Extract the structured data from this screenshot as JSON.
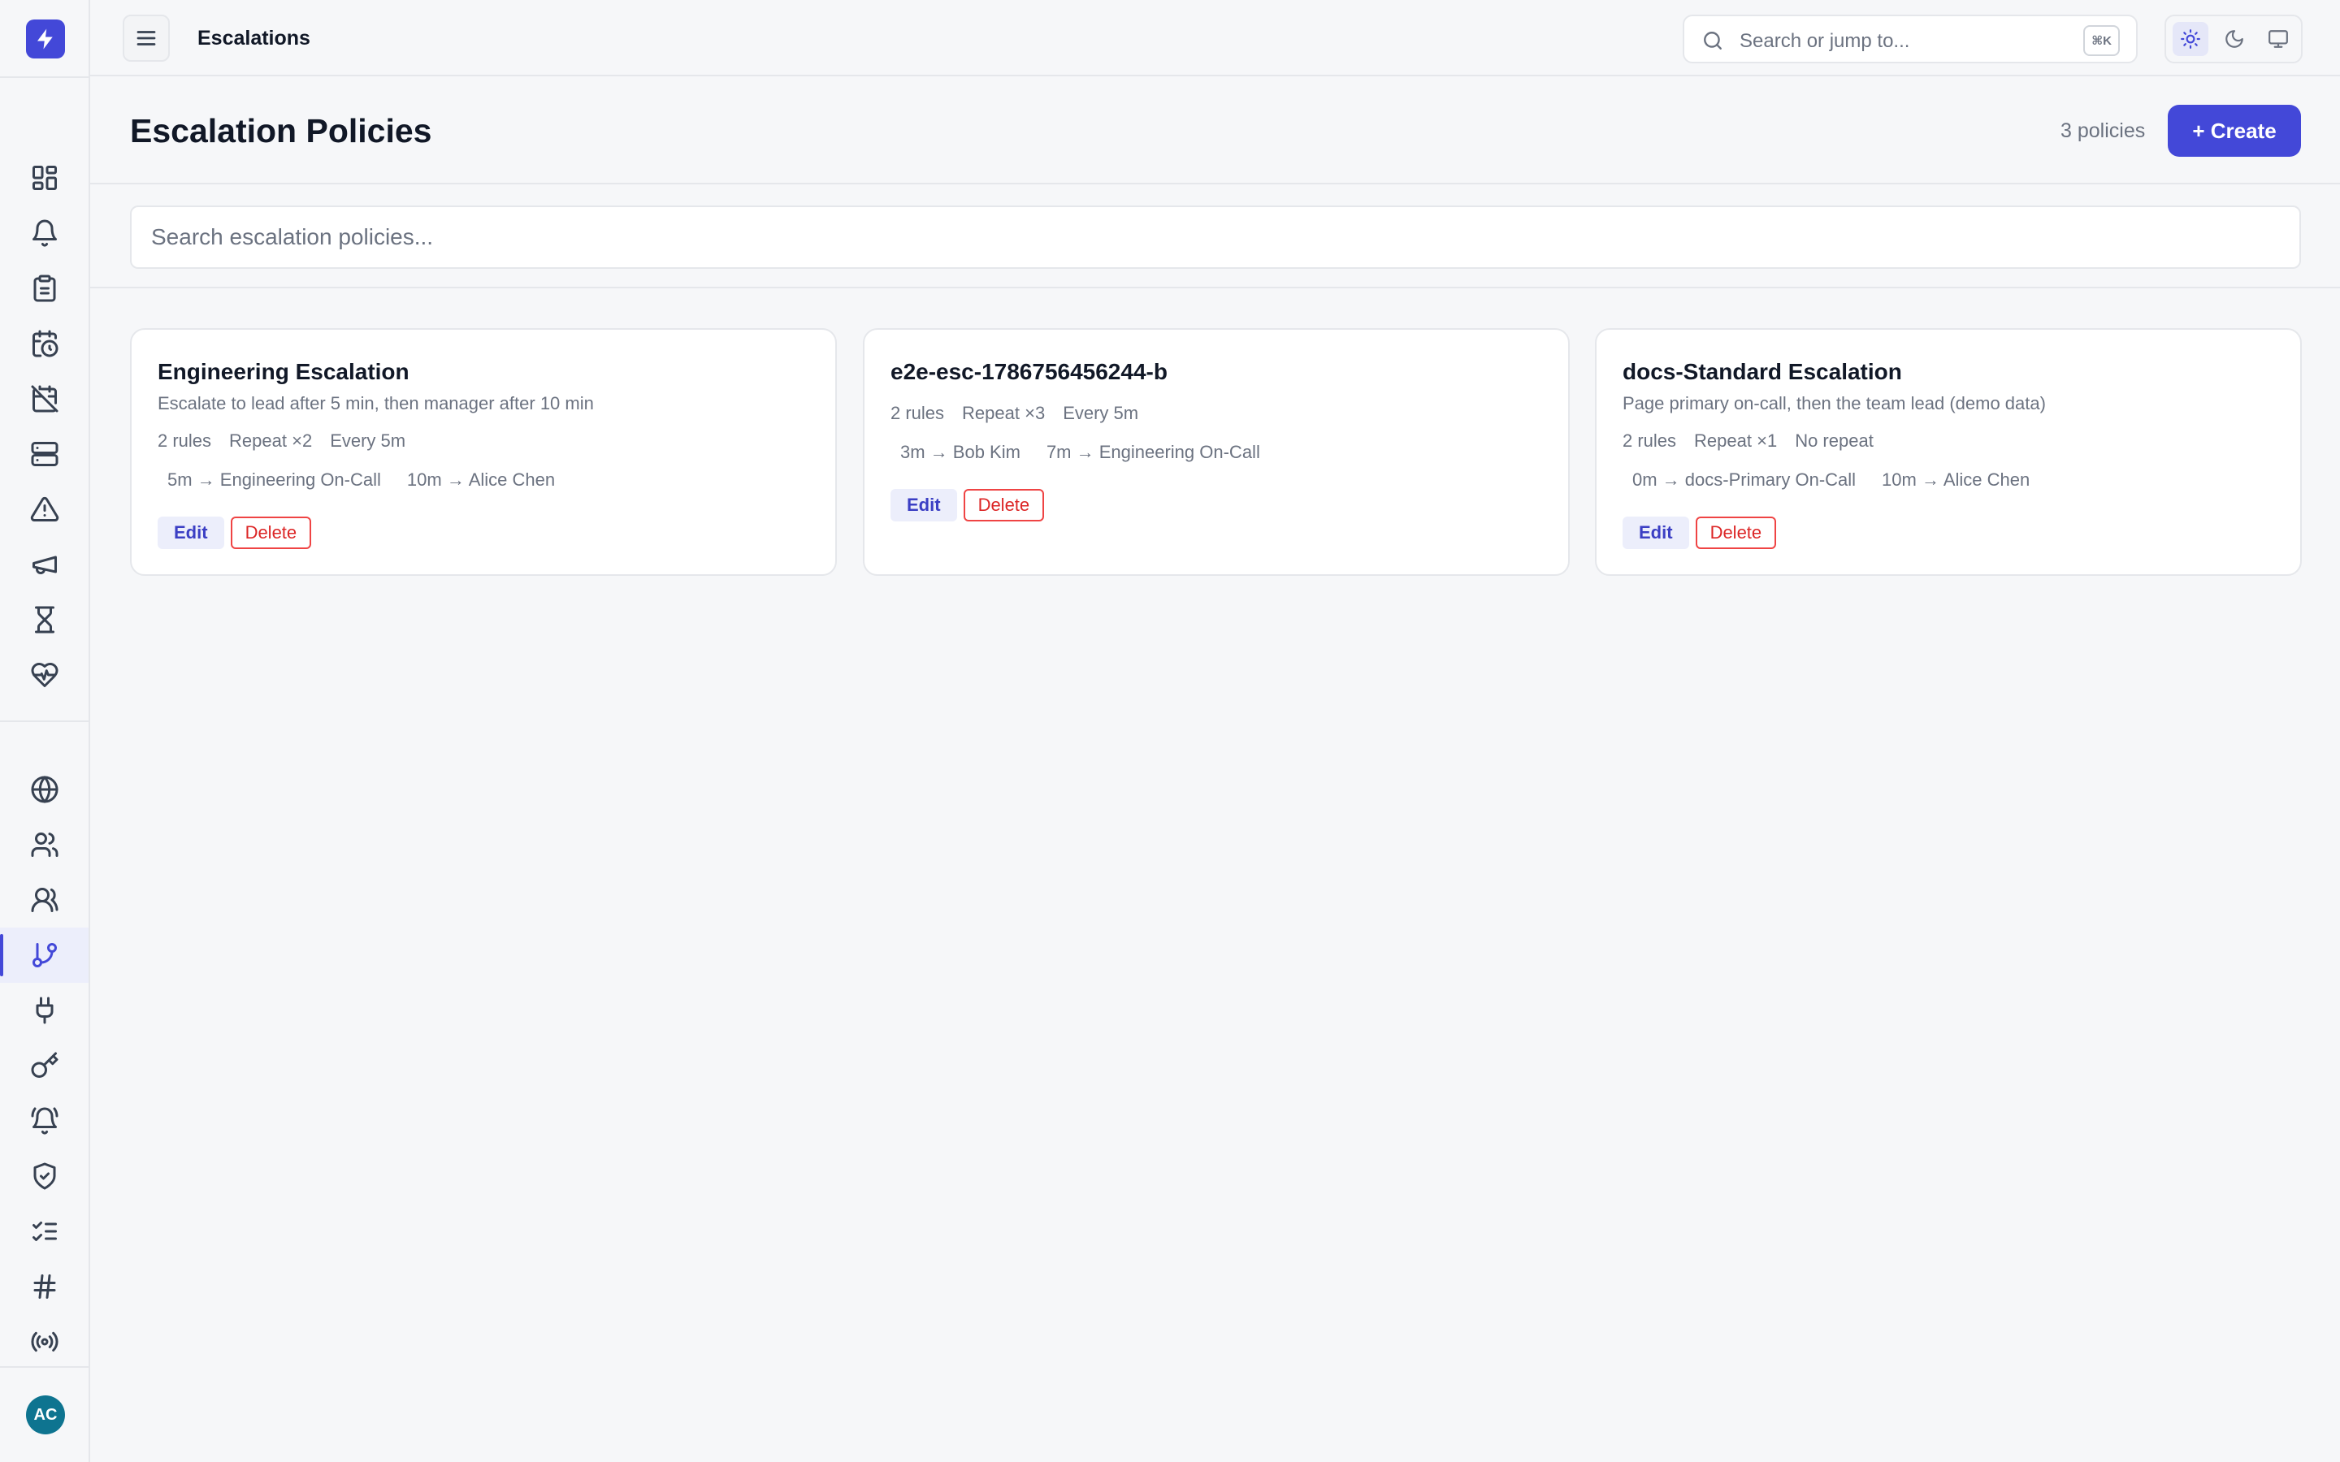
{
  "app": {
    "logo_icon": "bolt-icon",
    "accent": "#4348d8"
  },
  "topbar": {
    "breadcrumb": "Escalations",
    "search_placeholder": "Search or jump to...",
    "search_shortcut": "⌘K",
    "theme_selected": "light"
  },
  "sidebar": {
    "items": [
      {
        "icon": "dashboard-icon"
      },
      {
        "icon": "bell-icon"
      },
      {
        "icon": "clipboard-icon"
      },
      {
        "icon": "calendar-clock-icon"
      },
      {
        "icon": "calendar-off-icon"
      },
      {
        "icon": "server-icon"
      },
      {
        "icon": "alert-triangle-icon"
      },
      {
        "icon": "megaphone-icon"
      },
      {
        "icon": "hourglass-icon"
      },
      {
        "icon": "heart-pulse-icon"
      },
      {
        "icon": "globe-icon"
      },
      {
        "icon": "users-icon"
      },
      {
        "icon": "team-icon"
      },
      {
        "icon": "git-branch-icon",
        "active": true
      },
      {
        "icon": "plug-icon"
      },
      {
        "icon": "key-icon"
      },
      {
        "icon": "bell-ring-icon"
      },
      {
        "icon": "shield-check-icon"
      },
      {
        "icon": "list-checks-icon"
      },
      {
        "icon": "hash-icon"
      },
      {
        "icon": "radio-icon"
      }
    ],
    "user_initials": "AC",
    "avatar_color": "#0e7490"
  },
  "page": {
    "title": "Escalation Policies",
    "count": "3 policies",
    "create_label": "+ Create",
    "search_placeholder": "Search escalation policies..."
  },
  "policies": [
    {
      "name": "Engineering Escalation",
      "description": "Escalate to lead after 5 min, then manager after 10 min",
      "rules": "2 rules",
      "repeat": "Repeat ×2",
      "interval": "Every 5m",
      "steps": [
        "5m → Engineering On-Call",
        "10m → Alice Chen"
      ],
      "edit_label": "Edit",
      "delete_label": "Delete"
    },
    {
      "name": "e2e-esc-1786756456244-b",
      "description": "",
      "rules": "2 rules",
      "repeat": "Repeat ×3",
      "interval": "Every 5m",
      "steps": [
        "3m → Bob Kim",
        "7m → Engineering On-Call"
      ],
      "edit_label": "Edit",
      "delete_label": "Delete"
    },
    {
      "name": "docs-Standard Escalation",
      "description": "Page primary on-call, then the team lead (demo data)",
      "rules": "2 rules",
      "repeat": "Repeat ×1",
      "interval": "No repeat",
      "steps": [
        "0m → docs-Primary On-Call",
        "10m → Alice Chen"
      ],
      "edit_label": "Edit",
      "delete_label": "Delete"
    }
  ]
}
